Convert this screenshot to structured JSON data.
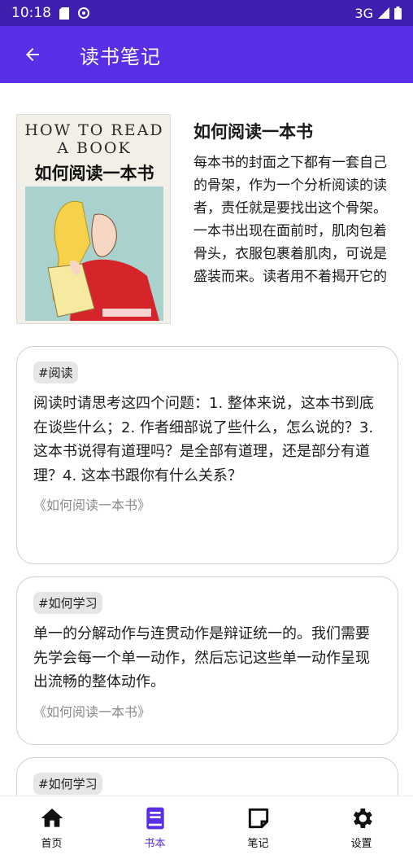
{
  "status_bar": {
    "time": "10:18",
    "network": "3G"
  },
  "app_bar": {
    "title": "读书笔记",
    "back_icon": "arrow-back-icon"
  },
  "book": {
    "cover": {
      "en_line1": "HOW TO READ",
      "en_line2": "A BOOK",
      "cn_title": "如何阅读一本书",
      "colors": {
        "background": "#f2efe6",
        "art": "#a9d2cf",
        "dress": "#d6252a",
        "hair": "#f5d24a"
      }
    },
    "title": "如何阅读一本书",
    "description": "每本书的封面之下都有一套自己的骨架，作为一个分析阅读的读者，责任就是要找出这个骨架。一本书出现在面前时，肌肉包着骨头，衣服包裹着肌肉，可说是盛装而来。读者用不着揭开它的"
  },
  "notes": [
    {
      "tag": "#阅读",
      "text": "阅读时请思考这四个问题：1. 整体来说，这本书到底在谈些什么；2. 作者细部说了些什么，怎么说的？3. 这本书说得有道理吗？是全部有道理，还是部分有道理？4. 这本书跟你有什么关系？",
      "source": "《如何阅读一本书》"
    },
    {
      "tag": "#如何学习",
      "text": "单一的分解动作与连贯动作是辩证统一的。我们需要先学会每一个单一动作，然后忘记这些单一动作呈现出流畅的整体动作。",
      "source": "《如何阅读一本书》"
    },
    {
      "tag": "#如何学习"
    }
  ],
  "bottom_nav": [
    {
      "label": "首页",
      "icon": "home-icon"
    },
    {
      "label": "书本",
      "icon": "book-icon"
    },
    {
      "label": "笔记",
      "icon": "note-icon"
    },
    {
      "label": "设置",
      "icon": "gear-icon"
    }
  ],
  "colors": {
    "primary": "#5a2ee6",
    "status_bar": "#3f1fb0",
    "tag_bg": "#e6e6e6",
    "source_text": "#8a8a8a"
  }
}
